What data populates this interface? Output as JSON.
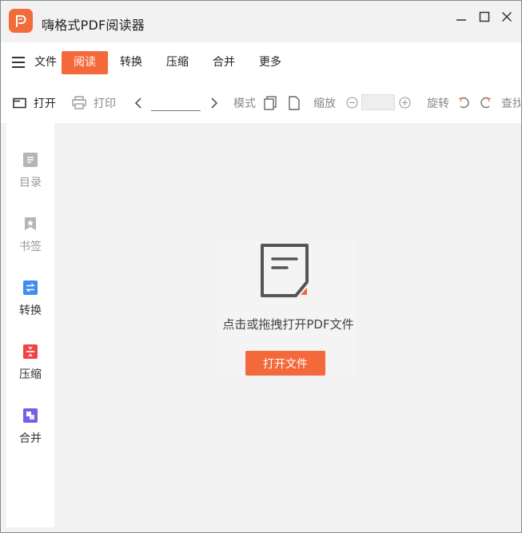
{
  "window": {
    "title": "嗨格式PDF阅读器"
  },
  "menu": {
    "items": [
      {
        "label": "文件"
      },
      {
        "label": "阅读"
      },
      {
        "label": "转换"
      },
      {
        "label": "压缩"
      },
      {
        "label": "合并"
      },
      {
        "label": "更多"
      }
    ],
    "active": "阅读"
  },
  "toolbar": {
    "open_label": "打开",
    "print_label": "打印",
    "page_value": "",
    "mode_label": "模式",
    "zoom_label": "缩放",
    "zoom_value": "",
    "rotate_label": "旋转",
    "find_label": "查找"
  },
  "sidebar": {
    "items": [
      {
        "label": "目录",
        "icon": "toc-icon",
        "color": "#b5b5b5"
      },
      {
        "label": "书签",
        "icon": "bookmark-icon",
        "color": "#b5b5b5"
      },
      {
        "label": "转换",
        "icon": "convert-icon",
        "color": "#3d8ef0"
      },
      {
        "label": "压缩",
        "icon": "compress-icon",
        "color": "#f04545"
      },
      {
        "label": "合并",
        "icon": "merge-icon",
        "color": "#7a5ce6"
      }
    ]
  },
  "main": {
    "hint": "点击或拖拽打开PDF文件",
    "open_button": "打开文件"
  },
  "colors": {
    "accent": "#f4693c",
    "logo": "#f26b3a"
  }
}
